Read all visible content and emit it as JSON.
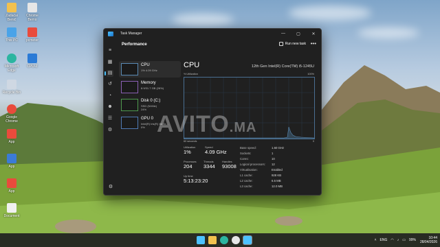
{
  "desktop": {
    "icons": [
      {
        "label": "Zadaćai Benić",
        "icon": "folder-icon",
        "color": "#f2c14e"
      },
      {
        "label": "Chrome Bemo",
        "icon": "chrome-icon",
        "color": "#e6e6e6"
      },
      {
        "label": "This PC",
        "icon": "pc-icon",
        "color": "#4aa3e8"
      },
      {
        "label": "pcmeter",
        "icon": "app-icon",
        "color": "#e94b3c"
      },
      {
        "label": "Microsoft Edge",
        "icon": "edge-icon",
        "color": "#2bb5a0"
      },
      {
        "label": "CPU-Z",
        "icon": "app-icon",
        "color": "#2b7bd6"
      },
      {
        "label": "Recycle Bin",
        "icon": "recycle-bin-icon",
        "color": "#cfd8e3"
      },
      {
        "label": "Google Chrome",
        "icon": "chrome-icon",
        "color": "#e94b3c"
      },
      {
        "label": "App",
        "icon": "app-icon",
        "color": "#e94b3c"
      },
      {
        "label": "App",
        "icon": "app-icon",
        "color": "#3b7bd6"
      },
      {
        "label": "App",
        "icon": "app-icon",
        "color": "#e94b3c"
      },
      {
        "label": "Document",
        "icon": "document-icon",
        "color": "#f0f0f0"
      }
    ]
  },
  "window": {
    "title": "Task Manager",
    "header": "Performance",
    "run_new_task": "Run new task",
    "more": "•••"
  },
  "sidebar": {
    "items": [
      {
        "title": "CPU",
        "sub": "1% 4.09 GHz"
      },
      {
        "title": "Memory",
        "sub": "8.9/31.7 GB (28%)"
      },
      {
        "title": "Disk 0 (C:)",
        "sub": "SSD (NVMe)\n24%"
      },
      {
        "title": "GPU 0",
        "sub": "Intel(R) Iris(R) Xe Gr...\n0%"
      }
    ]
  },
  "detail": {
    "title": "CPU",
    "processor": "12th Gen Intel(R) Core(TM) i5-1245U",
    "graph_label": "% Utilization",
    "graph_max": "100%",
    "graph_seconds": "60 seconds",
    "graph_zero": "0",
    "stats": {
      "utilization_label": "Utilization",
      "utilization": "1%",
      "speed_label": "Speed",
      "speed": "4.09 GHz",
      "processes_label": "Processes",
      "processes": "204",
      "threads_label": "Threads",
      "threads": "3344",
      "handles_label": "Handles",
      "handles": "93008",
      "uptime_label": "Up time",
      "uptime": "5:13:23:20"
    },
    "specs": [
      {
        "k": "Base speed:",
        "v": "1.60 GHz"
      },
      {
        "k": "Sockets:",
        "v": "1"
      },
      {
        "k": "Cores:",
        "v": "10"
      },
      {
        "k": "Logical processors:",
        "v": "12"
      },
      {
        "k": "Virtualisation:",
        "v": "Enabled"
      },
      {
        "k": "L1 cache:",
        "v": "928 KB"
      },
      {
        "k": "L2 cache:",
        "v": "6.5 MB"
      },
      {
        "k": "L3 cache:",
        "v": "12.0 MB"
      }
    ]
  },
  "watermark": {
    "main": "AVITO",
    "suffix": ".MA"
  },
  "taskbar": {
    "apps": [
      {
        "icon": "windows-start-icon",
        "color": "#4cc2ff"
      },
      {
        "icon": "file-explorer-icon",
        "color": "#f2c14e"
      },
      {
        "icon": "edge-icon",
        "color": "#2bb5a0"
      },
      {
        "icon": "chrome-icon",
        "color": "#e6e6e6"
      },
      {
        "icon": "task-manager-icon",
        "color": "#4cc2ff"
      }
    ],
    "tray": {
      "lang": "ENG",
      "battery": "99%",
      "time": "10:44",
      "date": "28/04/2026"
    }
  },
  "colors": {
    "accent": "#4cc2ff",
    "cpu_graph": "#5a8bb5"
  }
}
